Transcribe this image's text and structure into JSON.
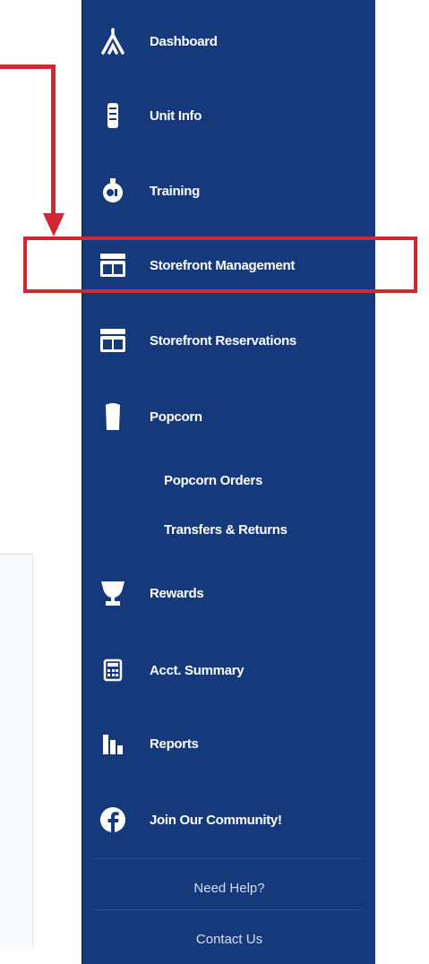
{
  "sidebar": {
    "items": [
      {
        "label": "Dashboard",
        "icon": "tent-icon"
      },
      {
        "label": "Unit Info",
        "icon": "document-stack-icon"
      },
      {
        "label": "Training",
        "icon": "training-badge-icon"
      },
      {
        "label": "Storefront Management",
        "icon": "storefront-icon"
      },
      {
        "label": "Storefront Reservations",
        "icon": "storefront-icon"
      },
      {
        "label": "Popcorn",
        "icon": "popcorn-box-icon"
      },
      {
        "label": "Popcorn Orders"
      },
      {
        "label": "Transfers & Returns"
      },
      {
        "label": "Rewards",
        "icon": "trophy-icon"
      },
      {
        "label": "Acct. Summary",
        "icon": "calculator-icon"
      },
      {
        "label": "Reports",
        "icon": "bar-chart-icon"
      },
      {
        "label": "Join Our Community!",
        "icon": "facebook-icon"
      }
    ],
    "help": {
      "need_help": "Need Help?",
      "contact": "Contact Us"
    }
  },
  "colors": {
    "sidebar_bg": "#15397a",
    "annotation_red": "#d22630",
    "text": "#ffffff"
  }
}
